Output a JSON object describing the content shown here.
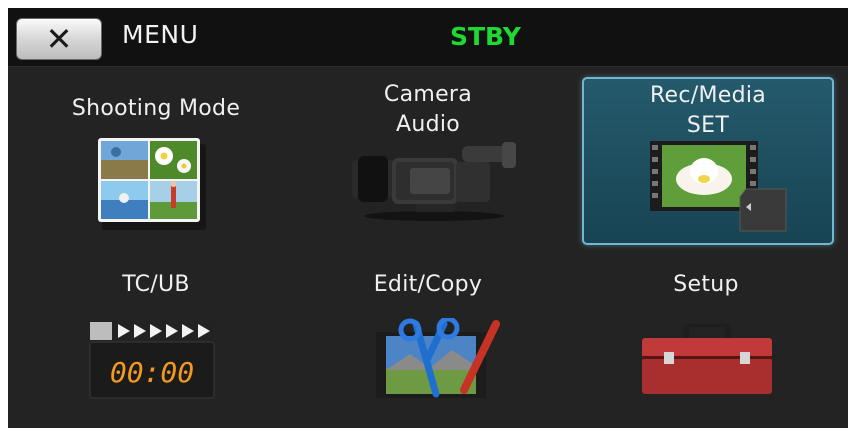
{
  "header": {
    "close_icon": "close-x-icon",
    "title": "MENU",
    "status": "STBY",
    "status_color": "#20d832"
  },
  "menu": {
    "items": [
      {
        "label": "Shooting Mode",
        "icon": "shooting-mode-icon"
      },
      {
        "label": "Camera\nAudio",
        "icon": "camcorder-icon"
      },
      {
        "label": "Rec/Media\nSET",
        "icon": "rec-media-icon",
        "selected": true
      },
      {
        "label": "TC/UB",
        "icon": "clapperboard-icon",
        "timecode": "00:00"
      },
      {
        "label": "Edit/Copy",
        "icon": "edit-copy-icon"
      },
      {
        "label": "Setup",
        "icon": "toolbox-icon"
      }
    ]
  },
  "colors": {
    "background": "#232323",
    "header": "#111111",
    "selected_tile": "#1e5264",
    "selected_border": "#73b6d0"
  }
}
